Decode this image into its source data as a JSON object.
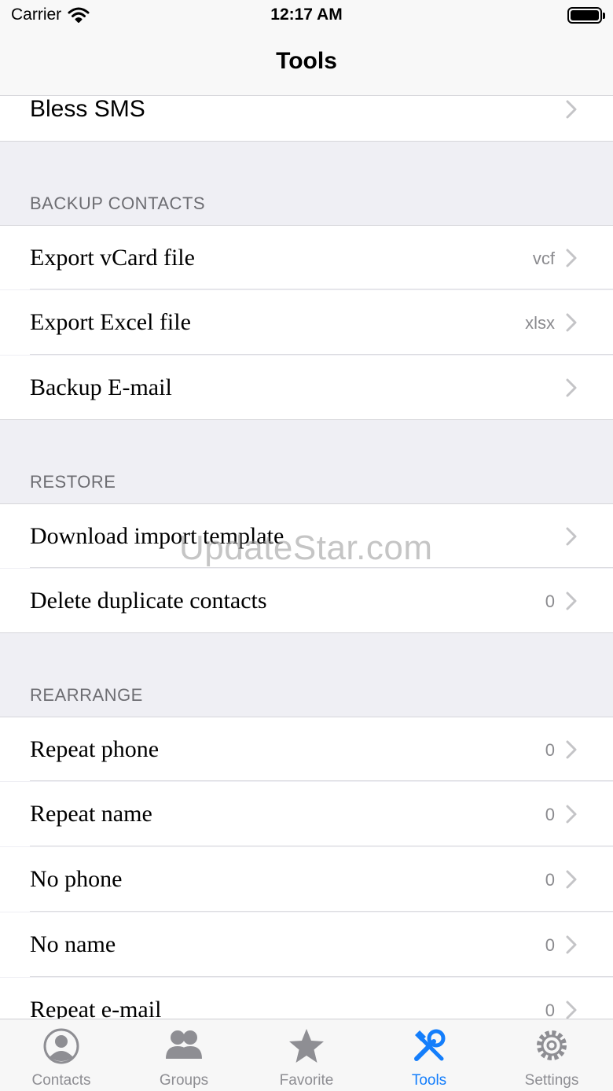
{
  "status_bar": {
    "carrier": "Carrier",
    "time": "12:17 AM"
  },
  "nav": {
    "title": "Tools"
  },
  "top_row": {
    "label": "Bless SMS"
  },
  "sections": {
    "backup": {
      "header": "BACKUP CONTACTS",
      "items": [
        {
          "label": "Export vCard file",
          "value": "vcf"
        },
        {
          "label": "Export Excel file",
          "value": "xlsx"
        },
        {
          "label": "Backup E-mail",
          "value": ""
        }
      ]
    },
    "restore": {
      "header": "RESTORE",
      "items": [
        {
          "label": "Download import template",
          "value": ""
        },
        {
          "label": "Delete duplicate contacts",
          "value": "0"
        }
      ]
    },
    "rearrange": {
      "header": "REARRANGE",
      "items": [
        {
          "label": "Repeat phone",
          "value": "0"
        },
        {
          "label": "Repeat name",
          "value": "0"
        },
        {
          "label": "No phone",
          "value": "0"
        },
        {
          "label": "No name",
          "value": "0"
        },
        {
          "label": "Repeat e-mail",
          "value": "0"
        }
      ]
    }
  },
  "watermark": "UpdateStar.com",
  "tabs": [
    {
      "label": "Contacts",
      "icon": "person-circle-icon",
      "active": false
    },
    {
      "label": "Groups",
      "icon": "groups-icon",
      "active": false
    },
    {
      "label": "Favorite",
      "icon": "star-icon",
      "active": false
    },
    {
      "label": "Tools",
      "icon": "tools-icon",
      "active": true
    },
    {
      "label": "Settings",
      "icon": "gear-icon",
      "active": false
    }
  ],
  "colors": {
    "accent": "#147efb",
    "inactive": "#8e8e93",
    "background": "#efeff4"
  }
}
